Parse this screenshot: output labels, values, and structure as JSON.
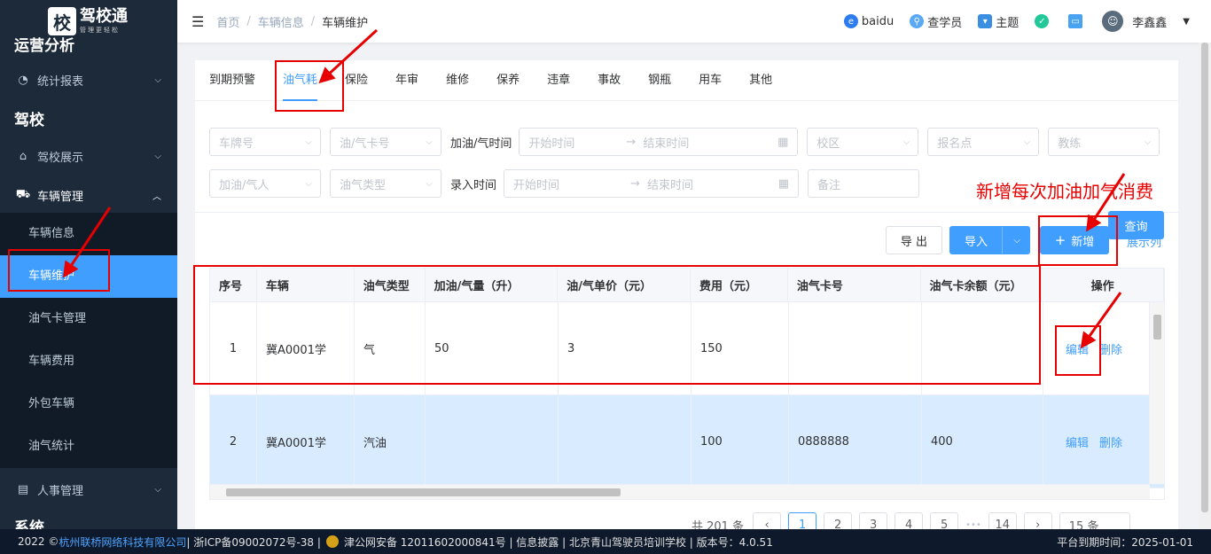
{
  "sidebar": {
    "logo_char": "校",
    "logo_name": "驾校通",
    "logo_slogan": "管理更轻松",
    "section_yunying": "运营分析",
    "stat_report": "统计报表",
    "section_jiaxiao": "驾校",
    "school_show": "驾校展示",
    "vehicle_mgmt": "车辆管理",
    "sub": [
      "车辆信息",
      "车辆维护",
      "油气卡管理",
      "车辆费用",
      "外包车辆",
      "油气统计"
    ],
    "hr_mgmt": "人事管理",
    "section_system": "系统"
  },
  "header": {
    "breadcrumb": [
      "首页",
      "车辆信息",
      "车辆维护"
    ],
    "baidu": "baidu",
    "query_student": "查学员",
    "theme": "主题",
    "user": "李鑫鑫"
  },
  "tabs": [
    "到期预警",
    "油气耗",
    "保险",
    "年审",
    "维修",
    "保养",
    "违章",
    "事故",
    "钢瓶",
    "用车",
    "其他"
  ],
  "filters": {
    "plate": "车牌号",
    "card_no": "油/气卡号",
    "refuel_time_label": "加油/气时间",
    "start": "开始时间",
    "end": "结束时间",
    "campus": "校区",
    "signup": "报名点",
    "coach": "教练",
    "refueler": "加油/气人",
    "fuel_type": "油气类型",
    "entry_time_label": "录入时间",
    "remark": "备注",
    "search_btn": "查询"
  },
  "toolbar": {
    "export": "导 出",
    "import": "导入",
    "add": "新增",
    "show_cols": "展示列"
  },
  "table": {
    "headers": [
      "序号",
      "车辆",
      "油气类型",
      "加油/气量（升）",
      "油/气单价（元）",
      "费用（元）",
      "油气卡号",
      "油气卡余额（元）",
      "操作"
    ],
    "rows": [
      [
        "1",
        "冀A0001学",
        "气",
        "50",
        "3",
        "150",
        "",
        ""
      ],
      [
        "2",
        "冀A0001学",
        "汽油",
        "",
        "",
        "100",
        "0888888",
        "400"
      ]
    ],
    "edit": "编辑",
    "delete": "删除"
  },
  "pager": {
    "total": "共 201 条",
    "pages": [
      "1",
      "2",
      "3",
      "4",
      "5",
      "14"
    ],
    "ellipsis": "•••",
    "size": "15 条"
  },
  "footer": {
    "copy": "2022 ©",
    "company": "杭州联桥网络科技有限公司",
    "icp": " | 浙ICP备09002072号-38 |",
    "police": "津公网安备 12011602000841号 | 信息披露 | 北京青山驾驶员培训学校 | 版本号：4.0.51",
    "expire": "平台到期时间：2025-01-01"
  },
  "annotation": "新增每次加油加气消费",
  "colors": {
    "primary": "#409eff",
    "sidebar": "#1c2a3a",
    "annot": "#e60000"
  }
}
